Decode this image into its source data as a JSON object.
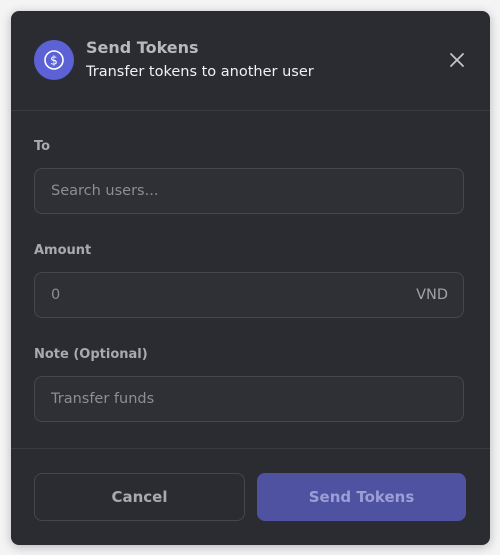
{
  "header": {
    "title": "Send Tokens",
    "subtitle": "Transfer tokens to another user",
    "icon": "dollar-coin-icon",
    "accent_color": "#5c62d6"
  },
  "form": {
    "to": {
      "label": "To",
      "placeholder": "Search users...",
      "value": ""
    },
    "amount": {
      "label": "Amount",
      "placeholder": "0",
      "value": "",
      "currency": "VND"
    },
    "note": {
      "label": "Note (Optional)",
      "placeholder": "Transfer funds",
      "value": ""
    }
  },
  "footer": {
    "cancel_label": "Cancel",
    "send_label": "Send Tokens",
    "send_color": "#4f52a0"
  }
}
